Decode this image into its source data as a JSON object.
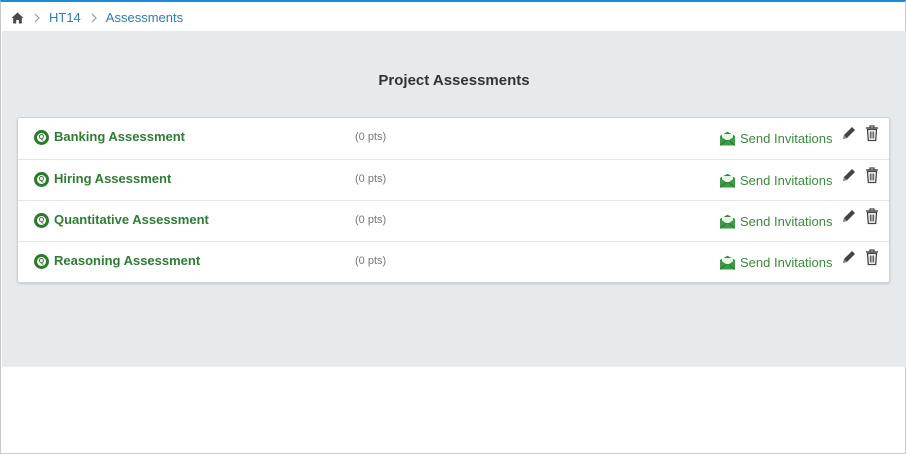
{
  "breadcrumb": {
    "home_icon": "home-icon",
    "items": [
      "HT14",
      "Assessments"
    ]
  },
  "page": {
    "title": "Project Assessments"
  },
  "assessments": [
    {
      "name": "Banking Assessment",
      "points": "(0 pts)",
      "send_label": "Send Invitations"
    },
    {
      "name": "Hiring Assessment",
      "points": "(0 pts)",
      "send_label": "Send Invitations"
    },
    {
      "name": "Quantitative Assessment",
      "points": "(0 pts)",
      "send_label": "Send Invitations"
    },
    {
      "name": "Reasoning Assessment",
      "points": "(0 pts)",
      "send_label": "Send Invitations"
    }
  ],
  "colors": {
    "accent": "#1b8bd6",
    "link": "#2a7dbb",
    "assessment_green": "#2e7d32",
    "panel_bg": "#e7eaed"
  }
}
